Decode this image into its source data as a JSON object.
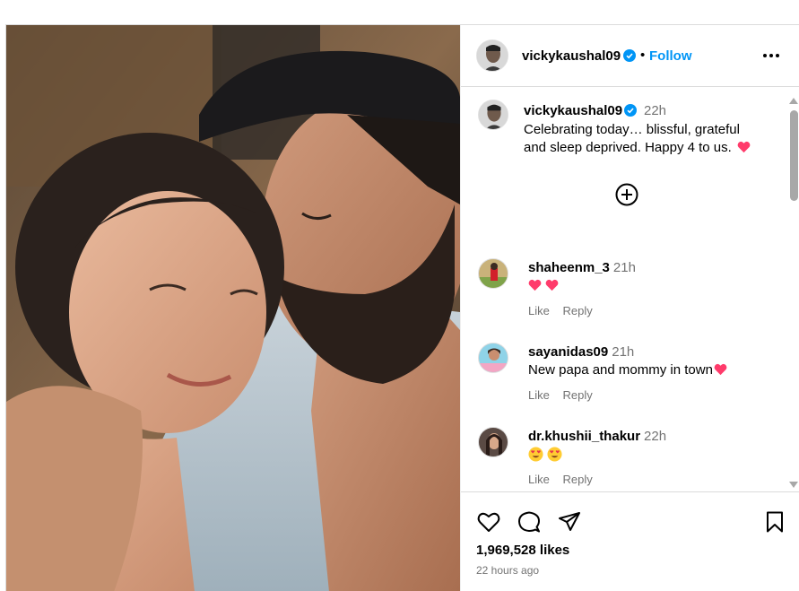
{
  "post": {
    "username": "vickykaushal09",
    "follow_label": "Follow",
    "dot": "•",
    "caption_user": "vickykaushal09",
    "caption_time": "22h",
    "caption_line1": "Celebrating today… blissful, grateful",
    "caption_line2": "and sleep deprived. Happy 4 to us."
  },
  "comments": [
    {
      "user": "shaheenm_3",
      "time": "21h",
      "text": "",
      "emoji": "heart-heart",
      "like_label": "Like",
      "reply_label": "Reply"
    },
    {
      "user": "sayanidas09",
      "time": "21h",
      "text": "New papa and mommy in town",
      "emoji": "heart",
      "like_label": "Like",
      "reply_label": "Reply"
    },
    {
      "user": "dr.khushii_thakur",
      "time": "22h",
      "text": "",
      "emoji": "heart-eyes-heart-eyes",
      "like_label": "Like",
      "reply_label": "Reply"
    }
  ],
  "footer": {
    "likes": "1,969,528 likes",
    "time_ago": "22 hours ago"
  },
  "colors": {
    "link_blue": "#0095f6",
    "muted": "#737373",
    "heart_red": "#ff3b6b",
    "verified": "#0095f6"
  },
  "icons": [
    "more-icon",
    "verified-icon",
    "plus-circle-icon",
    "heart-icon",
    "comment-icon",
    "share-icon",
    "bookmark-icon"
  ]
}
